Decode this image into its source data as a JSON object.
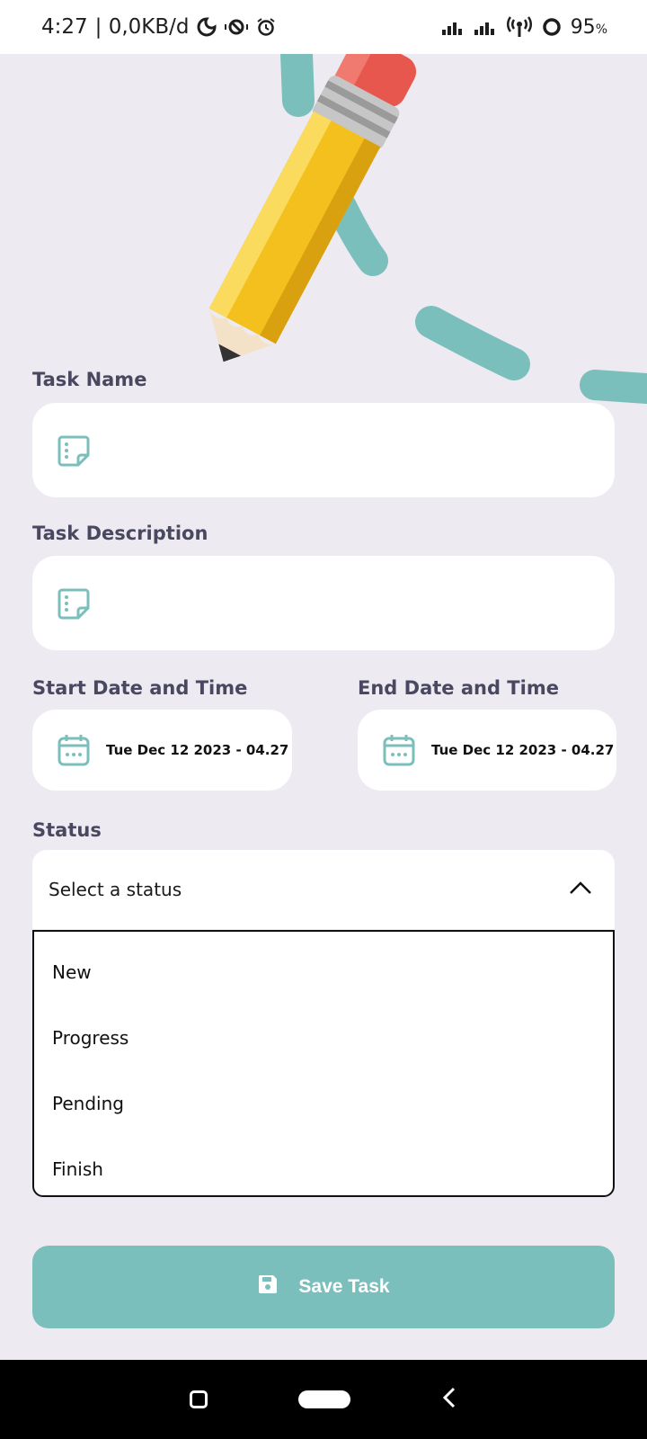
{
  "status_bar": {
    "time": "4:27",
    "net_speed": "| 0,0KB/d",
    "battery_percent": "95",
    "battery_unit": "%"
  },
  "form": {
    "task_name_label": "Task Name",
    "task_name_value": "",
    "task_description_label": "Task Description",
    "task_description_value": "",
    "start_label": "Start Date and Time",
    "start_value": "Tue Dec 12 2023 - 04.27",
    "end_label": "End Date and Time",
    "end_value": "Tue Dec 12 2023 - 04.27",
    "status_label": "Status",
    "status_placeholder": "Select a status",
    "status_options": [
      "New",
      "Progress",
      "Pending",
      "Finish"
    ],
    "save_label": "Save Task"
  },
  "icons": {
    "name_field": "note-icon",
    "description_field": "note-icon",
    "date_field": "calendar-icon",
    "dropdown_toggle": "chevron-up-icon",
    "save": "floppy-disk-icon"
  },
  "colors": {
    "accent": "#7BBFBC",
    "background": "#EDEBF1",
    "label": "#4A4860",
    "pencil_body": "#F4C01E",
    "eraser": "#E8574E"
  }
}
